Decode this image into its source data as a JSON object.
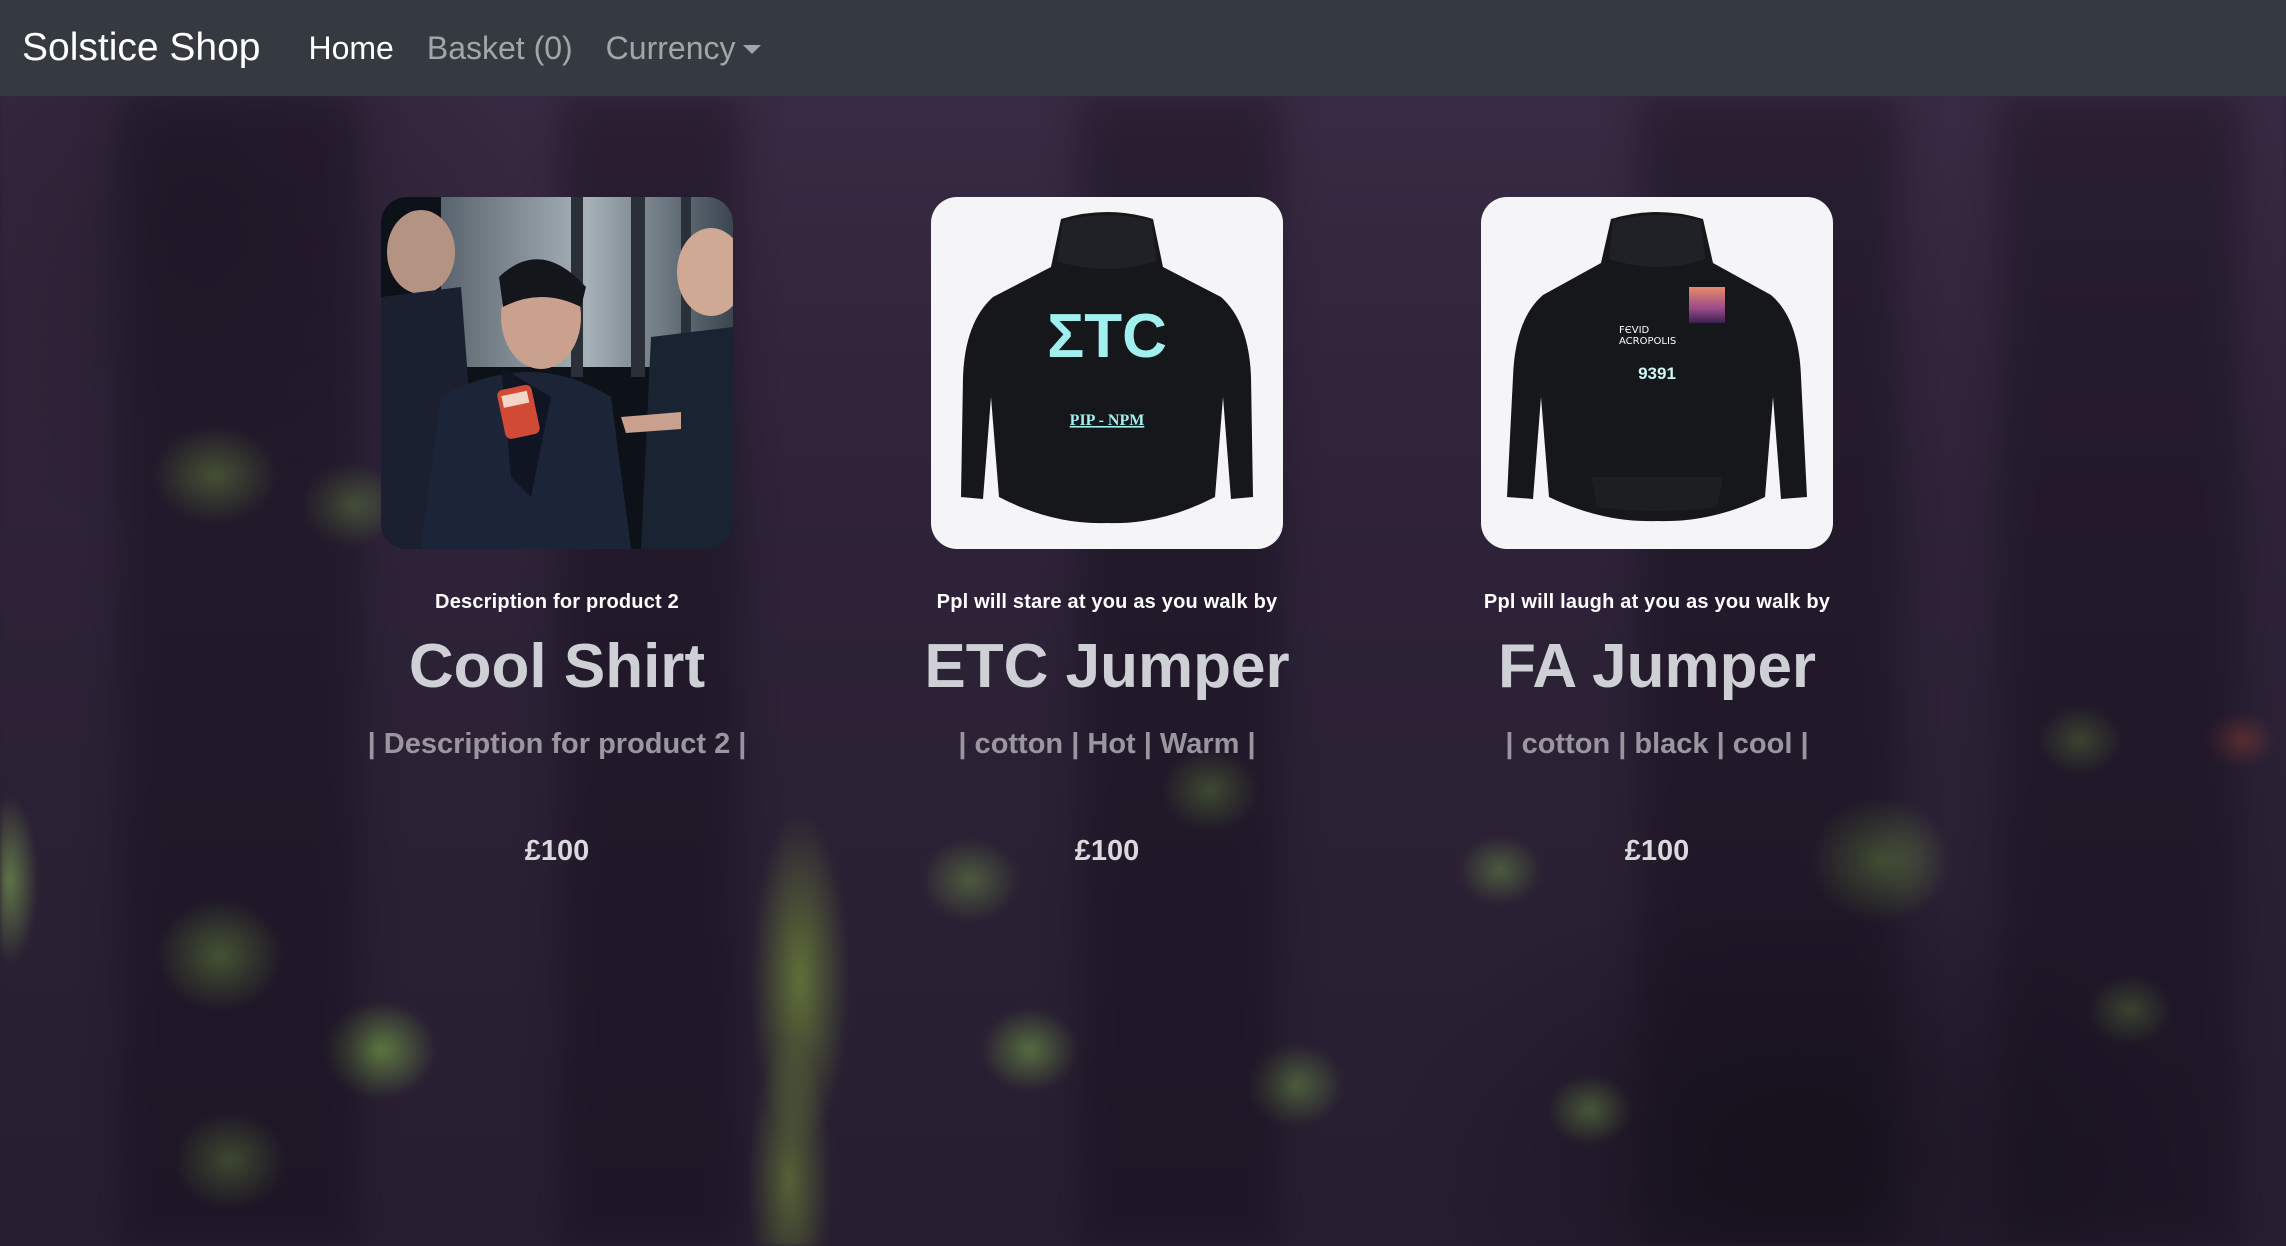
{
  "navbar": {
    "brand": "Solstice Shop",
    "home": "Home",
    "basket": "Basket (0)",
    "currency": "Currency"
  },
  "products": [
    {
      "image": "band-photo",
      "tagline": "Description for product 2",
      "name": "Cool Shirt",
      "tags": "| Description for product 2 |",
      "price": "£100"
    },
    {
      "image": "black-hoodie-etc-print",
      "print_main": "ΣTC",
      "print_sub": "PIP - NPM",
      "tagline": "Ppl will stare at you as you walk by",
      "name": "ETC Jumper",
      "tags": "| cotton | Hot | Warm |",
      "price": "£100"
    },
    {
      "image": "black-hoodie-fa-print",
      "print_line1": "FЄVID",
      "print_line2": "ACROPOLIS",
      "print_num": "9391",
      "tagline": "Ppl will laugh at you as you walk by",
      "name": "FA Jumper",
      "tags": "| cotton | black | cool |",
      "price": "£100"
    }
  ],
  "colors": {
    "navbar_bg": "#343a40",
    "print_cyan": "#9ff0ee",
    "background": "#2e2338"
  }
}
